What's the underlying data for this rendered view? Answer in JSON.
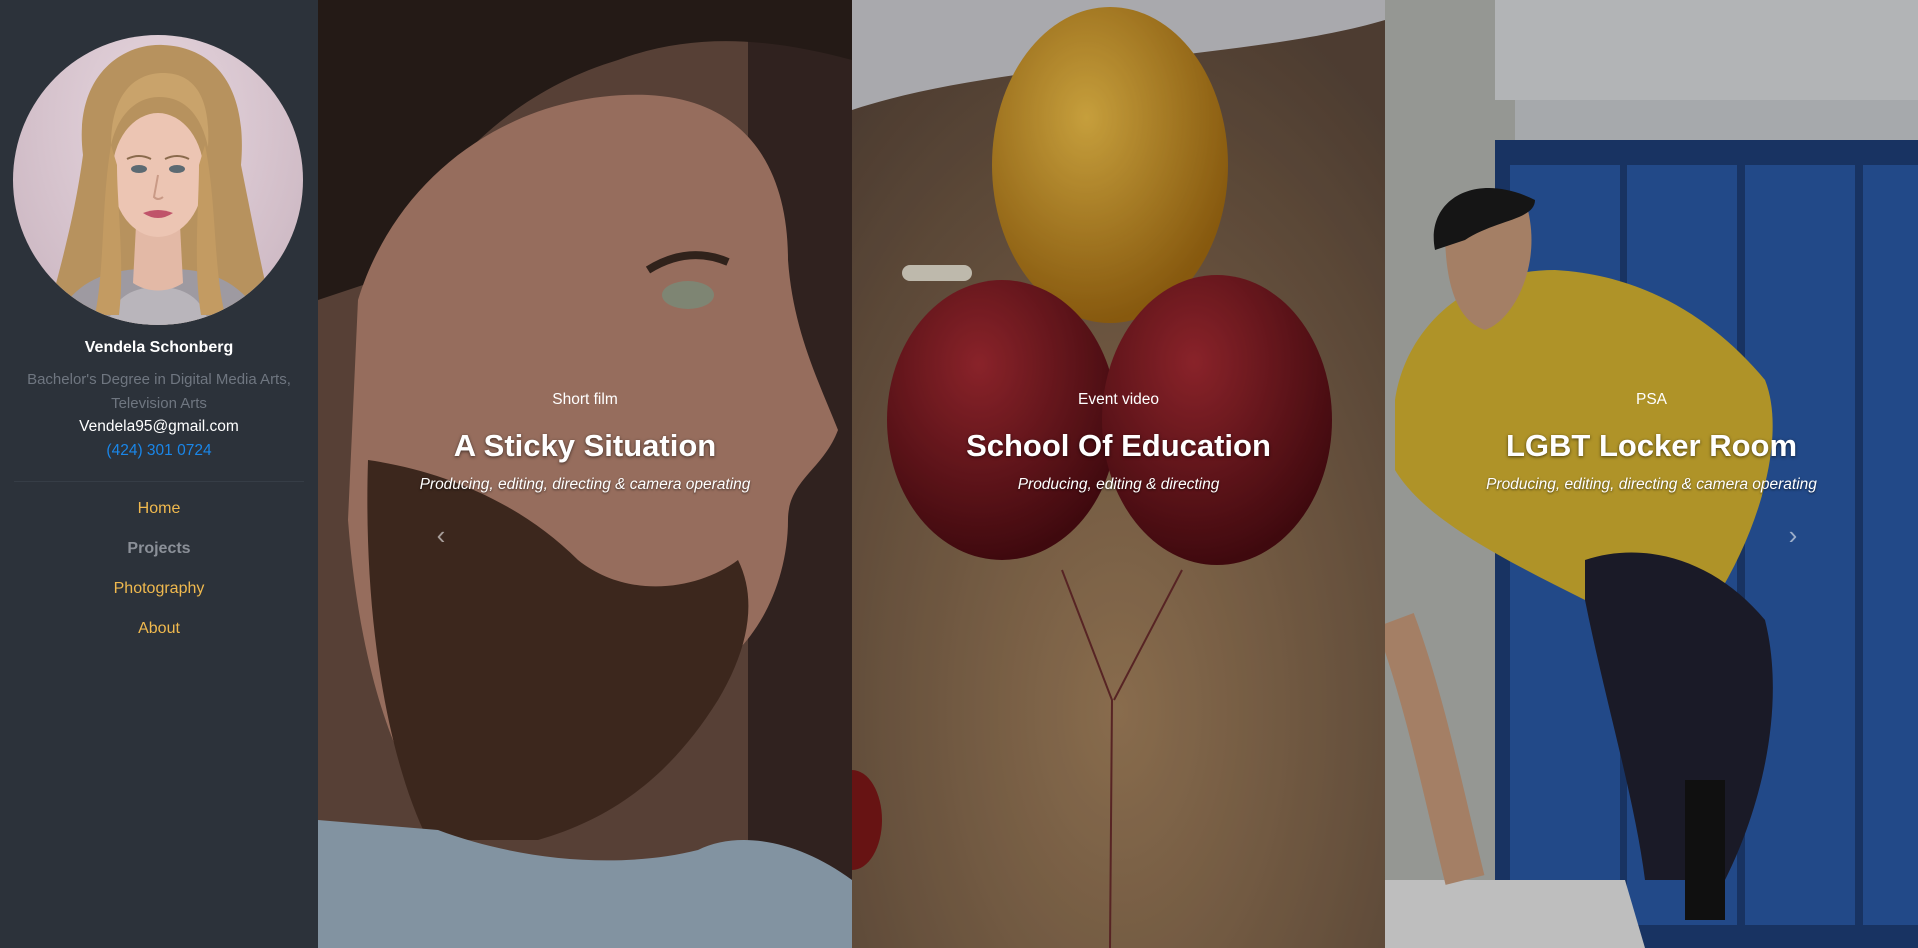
{
  "profile": {
    "name": "Vendela Schonberg",
    "degree": "Bachelor's Degree in Digital Media Arts, Television Arts",
    "email": "Vendela95@gmail.com",
    "phone": "(424) 301 0724"
  },
  "nav": {
    "items": [
      {
        "label": "Home"
      },
      {
        "label": "Projects"
      },
      {
        "label": "Photography"
      },
      {
        "label": "About"
      }
    ],
    "active": "Projects"
  },
  "slides": [
    {
      "type": "Short film",
      "title": "A Sticky Situation",
      "role": "Producing, editing, directing & camera operating"
    },
    {
      "type": "Event video",
      "title": "School Of Education",
      "role": "Producing, editing & directing"
    },
    {
      "type": "PSA",
      "title": "LGBT Locker Room",
      "role": "Producing, editing, directing & camera operating"
    }
  ],
  "controls": {
    "prev_icon": "chevron-left-icon",
    "next_icon": "chevron-right-icon",
    "prev_glyph": "‹",
    "next_glyph": "›"
  },
  "colors": {
    "sidebar_bg": "#2c323a",
    "nav_link": "#f0b94e",
    "nav_active": "#8b9098",
    "phone": "#1a86e8",
    "muted_text": "#6f7680"
  }
}
